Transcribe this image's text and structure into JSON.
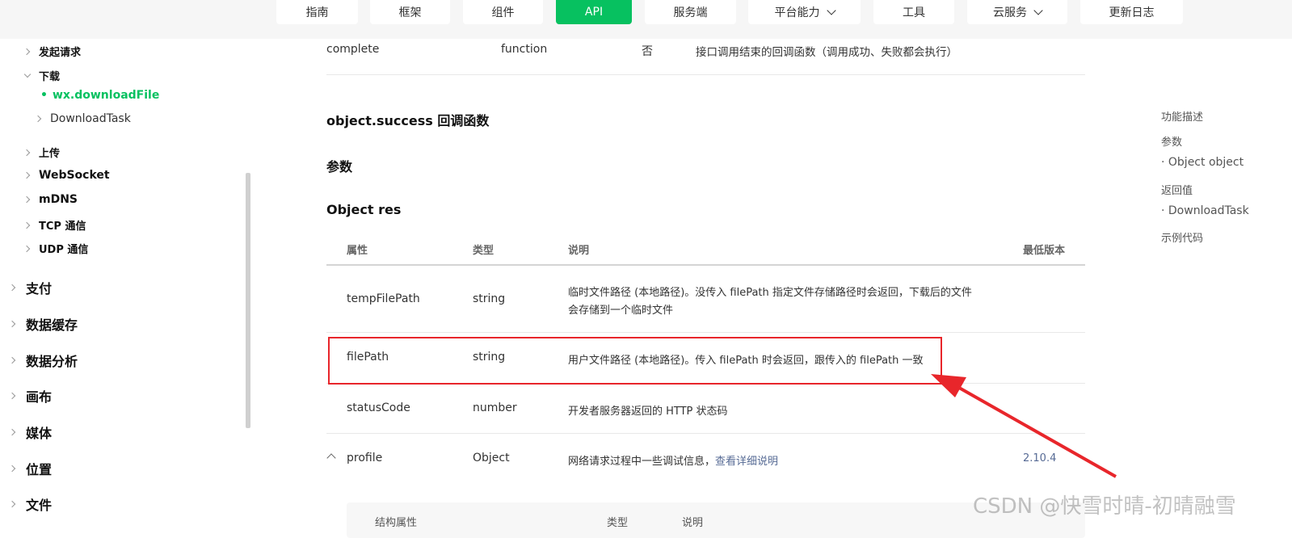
{
  "topnav": {
    "items": [
      {
        "label": "指南"
      },
      {
        "label": "框架"
      },
      {
        "label": "组件"
      },
      {
        "label": "API"
      },
      {
        "label": "服务端"
      },
      {
        "label": "平台能力"
      },
      {
        "label": "工具"
      },
      {
        "label": "云服务"
      },
      {
        "label": "更新日志"
      }
    ],
    "accent": "#07c160"
  },
  "sidebar": {
    "items": [
      {
        "label": "发起请求"
      },
      {
        "label": "下载"
      },
      {
        "label": "wx.downloadFile"
      },
      {
        "label": "DownloadTask"
      },
      {
        "label": "上传"
      },
      {
        "label": "WebSocket"
      },
      {
        "label": "mDNS"
      },
      {
        "label": "TCP 通信"
      },
      {
        "label": "UDP 通信"
      },
      {
        "label": "支付"
      },
      {
        "label": "数据缓存"
      },
      {
        "label": "数据分析"
      },
      {
        "label": "画布"
      },
      {
        "label": "媒体"
      },
      {
        "label": "位置"
      },
      {
        "label": "文件"
      }
    ]
  },
  "main": {
    "prev_row": {
      "name": "complete",
      "type": "function",
      "required": "否",
      "desc": "接口调用结束的回调函数（调用成功、失败都会执行）"
    },
    "section_title": "object.success 回调函数",
    "params_title": "参数",
    "object_title": "Object res",
    "table_headers": {
      "attr": "属性",
      "type": "类型",
      "desc": "说明",
      "min_version": "最低版本"
    },
    "rows": [
      {
        "name": "tempFilePath",
        "type": "string",
        "desc_line1": "临时文件路径 (本地路径)。没传入 filePath 指定文件存储路径时会返回，下载后的文件",
        "desc_line2": "会存储到一个临时文件"
      },
      {
        "name": "filePath",
        "type": "string",
        "desc": "用户文件路径 (本地路径)。传入 filePath 时会返回，跟传入的 filePath 一致"
      },
      {
        "name": "statusCode",
        "type": "number",
        "desc": "开发者服务器返回的 HTTP 状态码"
      },
      {
        "name": "profile",
        "type": "Object",
        "desc": "网络请求过程中一些调试信息，",
        "link": "查看详细说明",
        "version": "2.10.4"
      }
    ],
    "sub_headers": {
      "attr": "结构属性",
      "type": "类型",
      "desc": "说明"
    }
  },
  "toc": {
    "items": [
      {
        "label": "功能描述"
      },
      {
        "label": "参数"
      },
      {
        "label": "· Object object"
      },
      {
        "label": "返回值"
      },
      {
        "label": "· DownloadTask"
      },
      {
        "label": "示例代码"
      }
    ]
  },
  "watermark": "CSDN @快雪时晴-初晴融雪",
  "annotation_color": "#e8262b"
}
